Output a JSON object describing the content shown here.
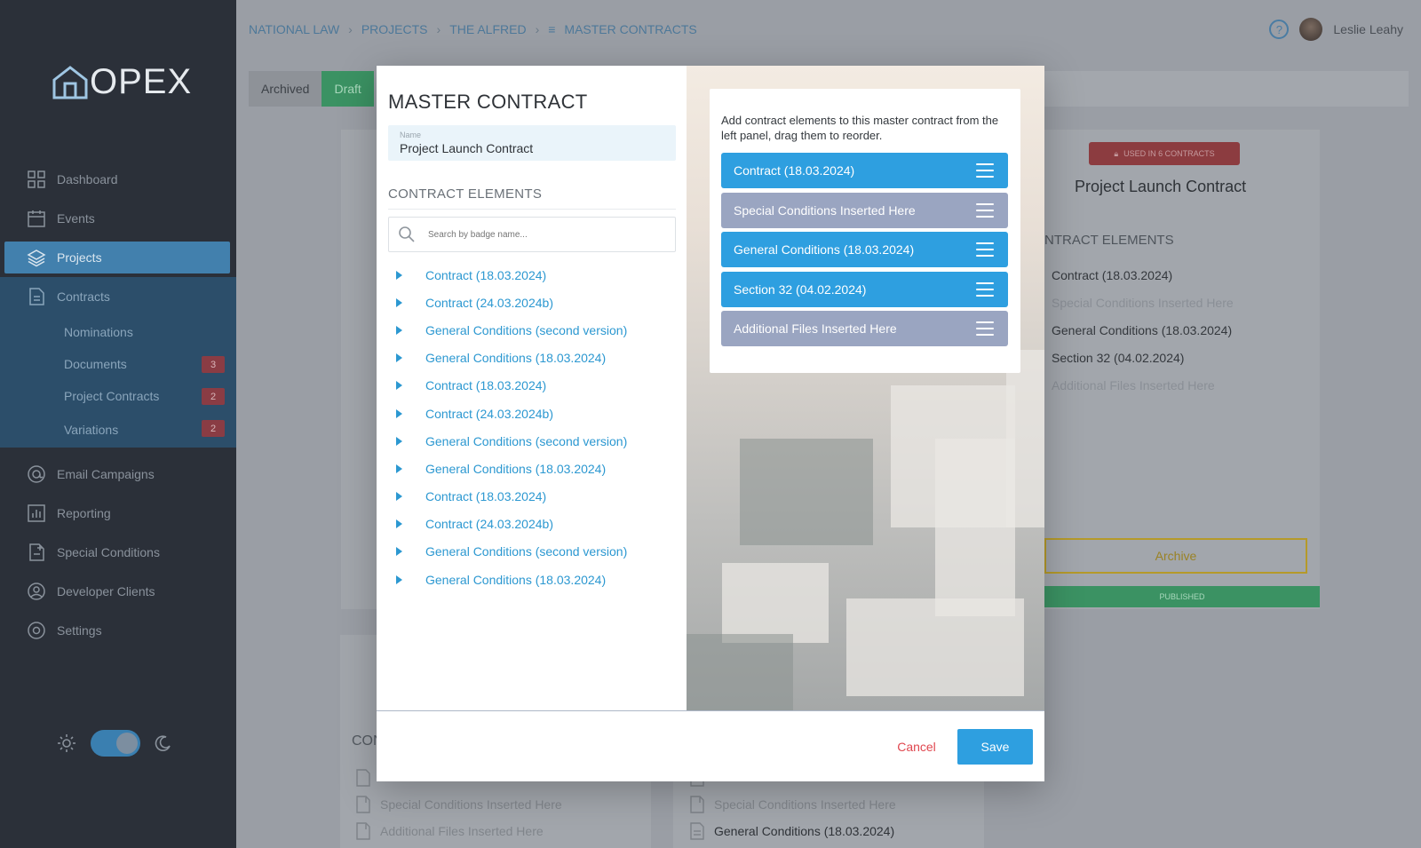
{
  "app": {
    "logo": "OPEX"
  },
  "breadcrumb": [
    "NATIONAL LAW",
    "PROJECTS",
    "THE ALFRED",
    "MASTER CONTRACTS"
  ],
  "user": {
    "name": "Leslie Leahy",
    "help": "?"
  },
  "sidebar": {
    "items": [
      {
        "label": "Dashboard",
        "icon": "grid-icon"
      },
      {
        "label": "Events",
        "icon": "calendar-icon"
      },
      {
        "label": "Projects",
        "icon": "layers-icon"
      },
      {
        "label": "Contracts",
        "icon": "document-icon"
      },
      {
        "label": "Email Campaigns",
        "icon": "at-icon"
      },
      {
        "label": "Reporting",
        "icon": "chart-icon"
      },
      {
        "label": "Special Conditions",
        "icon": "document-plus-icon"
      },
      {
        "label": "Developer Clients",
        "icon": "user-circle-icon"
      },
      {
        "label": "Settings",
        "icon": "gear-icon"
      }
    ],
    "subitems": [
      {
        "label": "Nominations",
        "badge": ""
      },
      {
        "label": "Documents",
        "badge": "3"
      },
      {
        "label": "Project Contracts",
        "badge": "2"
      },
      {
        "label": "Variations",
        "badge": "2"
      }
    ]
  },
  "background": {
    "tabs": [
      "Archived",
      "Draft"
    ],
    "used_badge": "USED IN 6 CONTRACTS",
    "card_title": "Project Launch Contract",
    "elements_header": "NTRACT ELEMENTS",
    "elements": [
      "Contract (18.03.2024)",
      "Special Conditions Inserted Here",
      "General Conditions (18.03.2024)",
      "Section 32 (04.02.2024)",
      "Additional Files Inserted Here"
    ],
    "archive": "Archive",
    "published": "PUBLISHED",
    "bottom_header": "CON",
    "bottom_left_rows": [
      "Special Conditions Inserted Here",
      "Additional Files Inserted Here"
    ],
    "bottom_right_rows": [
      "Special Conditions Inserted Here",
      "General Conditions (18.03.2024)"
    ]
  },
  "modal": {
    "title": "MASTER CONTRACT",
    "name_label": "Name",
    "name_value": "Project Launch Contract",
    "elements_header": "CONTRACT ELEMENTS",
    "search_placeholder": "Search by badge name...",
    "tree": [
      "Contract (18.03.2024)",
      "Contract (24.03.2024b)",
      "General Conditions (second version)",
      "General Conditions (18.03.2024)",
      "Contract (18.03.2024)",
      "Contract (24.03.2024b)",
      "General Conditions (second version)",
      "General Conditions (18.03.2024)",
      "Contract (18.03.2024)",
      "Contract (24.03.2024b)",
      "General Conditions (second version)",
      "General Conditions (18.03.2024)"
    ],
    "help_text": "Add contract elements to this master contract from the left panel, drag them to reorder.",
    "slots": [
      {
        "label": "Contract (18.03.2024)",
        "style": "blue"
      },
      {
        "label": "Special Conditions Inserted Here",
        "style": "gray"
      },
      {
        "label": "General Conditions (18.03.2024)",
        "style": "blue"
      },
      {
        "label": "Section 32 (04.02.2024)",
        "style": "blue"
      },
      {
        "label": "Additional Files Inserted Here",
        "style": "gray"
      }
    ],
    "cancel": "Cancel",
    "save": "Save"
  },
  "colors": {
    "accent": "#2e9fe0",
    "danger": "#e0474f",
    "placeholder_slot": "#9aa5c1"
  }
}
